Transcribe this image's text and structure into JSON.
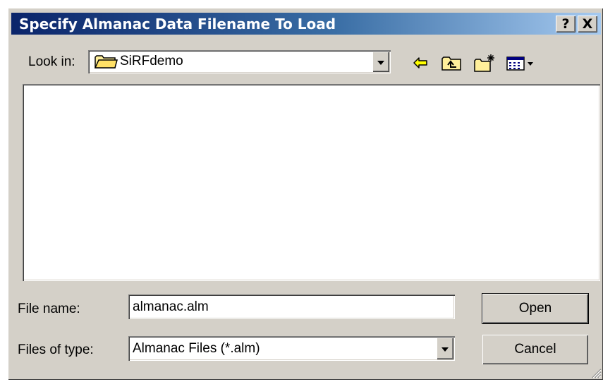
{
  "window": {
    "title": "Specify Almanac Data Filename To Load",
    "help_label": "?",
    "close_label": "X"
  },
  "look_in": {
    "label": "Look in:",
    "value": "SiRFdemo",
    "icon": "folder-icon"
  },
  "toolbar": {
    "icons": [
      "back-arrow-icon",
      "up-one-level-icon",
      "create-new-folder-icon",
      "view-menu-icon"
    ]
  },
  "file_name": {
    "label": "File name:",
    "value": "almanac.alm"
  },
  "file_type": {
    "label": "Files of type:",
    "value": "Almanac Files (*.alm)"
  },
  "buttons": {
    "open": "Open",
    "cancel": "Cancel"
  }
}
